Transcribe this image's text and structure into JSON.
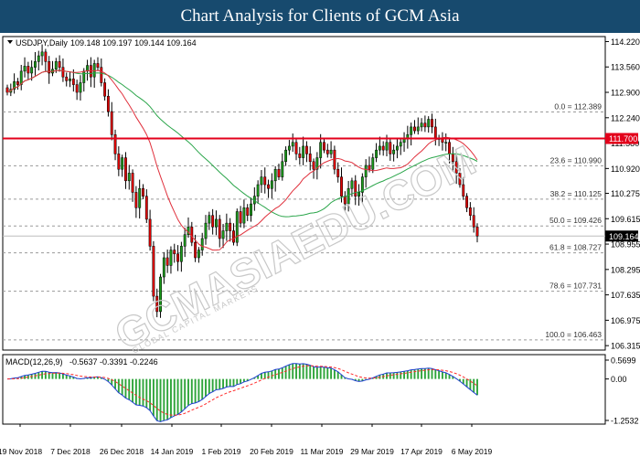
{
  "header": {
    "title": "Chart Analysis for Clients of GCM Asia"
  },
  "watermark": {
    "text": "GCMASIAEDU.COM",
    "subtext": "GLOBAL CAPITAL MARKETS"
  },
  "colors": {
    "banner": "#174a6e",
    "up_candle": "#1a9a1a",
    "down_candle": "#e00000",
    "resistance": "#e3001b",
    "ma_fast": "#e0303c",
    "ma_slow": "#2aa54a",
    "macd_line": "#1f3fd0",
    "signal_line": "#ff2a2a",
    "histogram": "#2ea43a",
    "last_price_label": "#000000"
  },
  "chart_data": [
    {
      "type": "candlestick",
      "symbol_label": "USDJPY,Daily",
      "ohlc_label": "109.148 109.197 109.144 109.164",
      "x_tick_labels": [
        "19 Nov 2018",
        "7 Dec 2018",
        "26 Dec 2018",
        "14 Jan 2019",
        "1 Feb 2019",
        "20 Feb 2019",
        "11 Mar 2019",
        "29 Mar 2019",
        "17 Apr 2019",
        "6 May 2019"
      ],
      "y_tick_labels": [
        "114.220",
        "113.560",
        "112.900",
        "112.240",
        "111.580",
        "110.920",
        "110.275",
        "109.615",
        "108.955",
        "108.295",
        "107.635",
        "106.975",
        "106.315"
      ],
      "ylim": [
        106.2,
        114.35
      ],
      "resistance": {
        "value": 111.7,
        "label": "111.700"
      },
      "last_price": {
        "value": 109.164,
        "label": "109.164"
      },
      "fibonacci": [
        {
          "label": "0.0 = 112.389",
          "value": 112.389
        },
        {
          "label": "23.6 = 110.990",
          "value": 110.99
        },
        {
          "label": "38.2 = 110.125",
          "value": 110.125
        },
        {
          "label": "50.0 = 109.426",
          "value": 109.426
        },
        {
          "label": "61.8 = 108.727",
          "value": 108.727
        },
        {
          "label": "78.6 = 107.731",
          "value": 107.731
        },
        {
          "label": "100.0 = 106.463",
          "value": 106.463
        }
      ],
      "closes": [
        112.9,
        112.98,
        113.18,
        113.1,
        113.45,
        113.58,
        113.4,
        113.55,
        113.7,
        113.85,
        113.95,
        113.7,
        113.4,
        113.5,
        113.7,
        113.55,
        113.3,
        113.2,
        113.25,
        113.1,
        112.9,
        113.15,
        113.45,
        113.6,
        113.3,
        113.65,
        113.55,
        113.15,
        112.8,
        112.4,
        111.8,
        111.3,
        110.9,
        111.2,
        110.6,
        110.8,
        110.3,
        109.9,
        110.4,
        110.2,
        109.6,
        108.9,
        107.6,
        107.2,
        108.1,
        108.6,
        108.4,
        108.8,
        108.7,
        108.5,
        108.9,
        109.2,
        109.4,
        109.0,
        108.6,
        108.8,
        109.1,
        109.5,
        109.7,
        109.4,
        109.6,
        109.1,
        109.3,
        109.5,
        109.3,
        109.0,
        109.8,
        109.5,
        109.9,
        109.7,
        110.0,
        110.2,
        110.5,
        110.7,
        110.5,
        110.4,
        110.6,
        110.9,
        110.7,
        111.1,
        111.4,
        111.5,
        111.6,
        111.3,
        111.2,
        111.5,
        111.3,
        111.1,
        110.9,
        111.2,
        111.6,
        111.4,
        111.3,
        111.4,
        110.9,
        110.7,
        110.2,
        110.0,
        110.4,
        110.6,
        110.2,
        110.3,
        110.7,
        111.0,
        110.9,
        111.2,
        111.4,
        111.5,
        111.4,
        111.6,
        111.3,
        111.4,
        111.5,
        111.6,
        111.7,
        111.8,
        112.0,
        111.9,
        112.0,
        112.1,
        112.0,
        112.2,
        112.0,
        111.7,
        111.7,
        111.6,
        111.6,
        111.3,
        111.1,
        110.8,
        110.5,
        110.2,
        109.9,
        109.7,
        109.4,
        109.164
      ],
      "sma_fast_period_label": "",
      "sma_slow_period_label": ""
    },
    {
      "type": "macd",
      "label": "MACD(12,26,9)",
      "values_label": "-0.5637 -0.3391 -0.2246",
      "y_tick_labels": [
        "0.5699",
        "0.00",
        "-1.2532"
      ],
      "ylim": [
        -1.2532,
        0.5699
      ]
    }
  ]
}
